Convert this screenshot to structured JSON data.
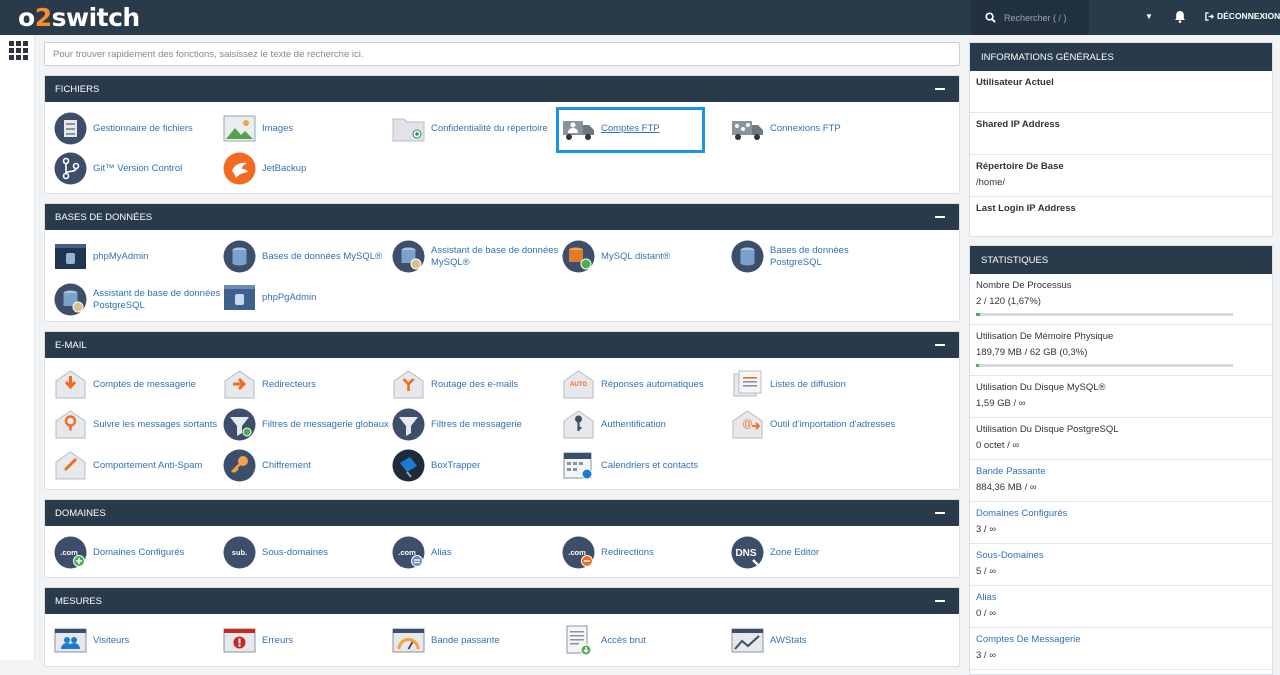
{
  "brand": {
    "logo_a": "o",
    "logo_b": "2",
    "logo_c": "switch"
  },
  "topbar": {
    "search_placeholder": "Rechercher ( / )",
    "logout": "DÉCONNEXION"
  },
  "search": {
    "placeholder": "Pour trouver rapidement des fonctions, saisissez le texte de recherche ici."
  },
  "sections": {
    "fichiers": {
      "title": "FICHIERS",
      "items": [
        "Gestionnaire de fichiers",
        "Images",
        "Confidentialité du répertoire",
        "Comptes FTP",
        "Connexions FTP",
        "Git™ Version Control",
        "JetBackup"
      ]
    },
    "bdd": {
      "title": "BASES DE DONNÉES",
      "items": [
        "phpMyAdmin",
        "Bases de données MySQL®",
        "Assistant de base de données MySQL®",
        "MySQL distant®",
        "Bases de données PostgreSQL",
        "Assistant de base de données PostgreSQL",
        "phpPgAdmin"
      ]
    },
    "email": {
      "title": "E-MAIL",
      "items": [
        "Comptes de messagerie",
        "Redirecteurs",
        "Routage des e-mails",
        "Réponses automatiques",
        "Listes de diffusion",
        "Suivre les messages sortants",
        "Filtres de messagerie globaux",
        "Filtres de messagerie",
        "Authentification",
        "Outil d’importation d’adresses",
        "Comportement Anti-Spam",
        "Chiffrement",
        "BoxTrapper",
        "Calendriers et contacts"
      ]
    },
    "domaines": {
      "title": "DOMAINES",
      "items": [
        "Domaines Configurés",
        "Sous-domaines",
        "Alias",
        "Redirections",
        "Zone Editor"
      ]
    },
    "mesures": {
      "title": "MESURES",
      "items": [
        "Visiteurs",
        "Erreurs",
        "Bande passante",
        "Accès brut",
        "AWStats"
      ]
    }
  },
  "icon_text": {
    "com": ".com",
    "sub": "sub.",
    "dns": "DNS",
    "auto": "AUTO"
  },
  "info": {
    "title": "INFORMATIONS GÉNÉRALES",
    "rows": [
      {
        "label": "Utilisateur Actuel",
        "value": ""
      },
      {
        "label": "Shared IP Address",
        "value": ""
      },
      {
        "label": "Répertoire De Base",
        "value": "/home/"
      },
      {
        "label": "Last Login IP Address",
        "value": ""
      }
    ]
  },
  "stats": {
    "title": "STATISTIQUES",
    "rows": [
      {
        "label": "Nombre De Processus",
        "value": "2 / 120   (1,67%)",
        "fill": 0.0167
      },
      {
        "label": "Utilisation De Mémoire Physique",
        "value": "189,79 MB / 62 GB   (0,3%)",
        "fill": 0.003
      },
      {
        "label": "Utilisation Du Disque MySQL®",
        "value": "1,59 GB / ∞"
      },
      {
        "label": "Utilisation Du Disque PostgreSQL",
        "value": "0 octet / ∞"
      },
      {
        "label": "Bande Passante",
        "value": "884,36 MB / ∞"
      },
      {
        "label": "Domaines Configurés",
        "value": "3 / ∞"
      },
      {
        "label": "Sous-Domaines",
        "value": "5 / ∞"
      },
      {
        "label": "Alias",
        "value": "0 / ∞"
      },
      {
        "label": "Comptes De Messagerie",
        "value": "3 / ∞"
      }
    ]
  },
  "colors": {
    "navy": "#293a4a",
    "link": "#2f72b8",
    "orange": "#fb8c2b",
    "highlight": "#1d93e3"
  }
}
